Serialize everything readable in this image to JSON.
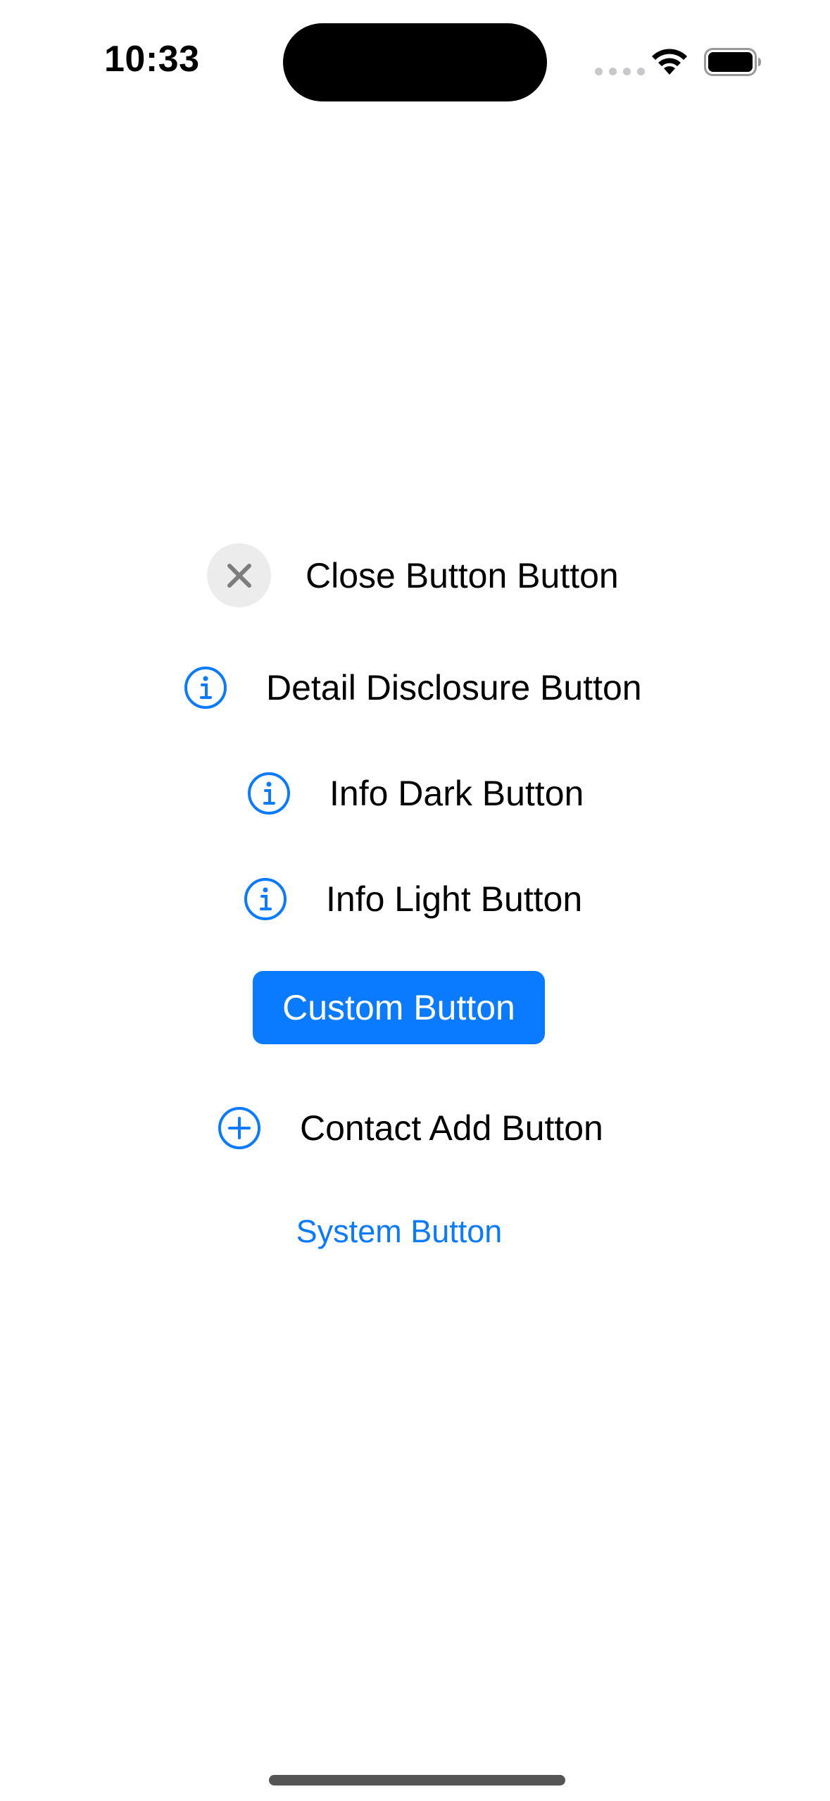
{
  "status_bar": {
    "time": "10:33"
  },
  "buttons": {
    "close": {
      "label": "Close Button Button",
      "icon": "close-icon"
    },
    "detail_disclosure": {
      "label": "Detail Disclosure Button",
      "icon": "info-icon"
    },
    "info_dark": {
      "label": "Info Dark Button",
      "icon": "info-icon"
    },
    "info_light": {
      "label": "Info Light Button",
      "icon": "info-icon"
    },
    "custom": {
      "label": "Custom Button"
    },
    "contact_add": {
      "label": "Contact Add Button",
      "icon": "plus-circle-icon"
    },
    "system": {
      "label": "System Button"
    }
  },
  "colors": {
    "accent": "#0a7aff",
    "close_bg": "#ececec",
    "close_glyph": "#7d7d80",
    "text": "#000000",
    "background": "#ffffff"
  }
}
